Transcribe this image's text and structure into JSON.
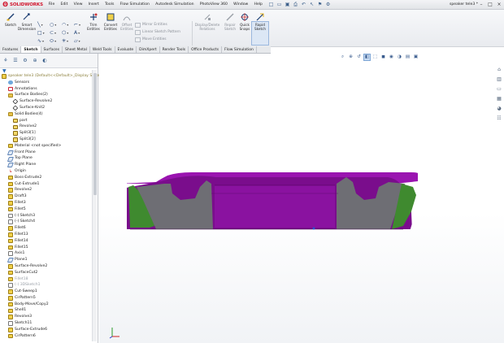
{
  "app": {
    "logo_text": "SOLIDWORKS",
    "doc_title": "speaker tele3 *"
  },
  "menu": [
    "File",
    "Edit",
    "View",
    "Insert",
    "Tools",
    "Flow Simulation",
    "Autodesk Simulation",
    "PhotoView 360",
    "Window",
    "Help"
  ],
  "command_manager": {
    "big": [
      {
        "label": "Sketch"
      },
      {
        "label": "Smart\nDimension"
      },
      {
        "label": "Trim\nEntities"
      },
      {
        "label": "Convert\nEntities"
      },
      {
        "label": "Offset\nEntities"
      },
      {
        "label": "Display/Delete\nRelations"
      },
      {
        "label": "Repair\nSketch"
      },
      {
        "label": "Quick\nSnaps"
      },
      {
        "label": "Rapid\nSketch"
      }
    ],
    "list": [
      "Mirror Entities",
      "Linear Sketch Pattern",
      "Move Entities"
    ]
  },
  "tabs": [
    "Features",
    "Sketch",
    "Surfaces",
    "Sheet Metal",
    "Weld Tools",
    "Evaluate",
    "DimXpert",
    "Render Tools",
    "Office Products",
    "Flow Simulation"
  ],
  "active_tab": "Sketch",
  "tree": [
    {
      "label": "speaker tele3 (Default<<Default>_Display State 1>)",
      "indent": 0,
      "icon": "root",
      "root": true
    },
    {
      "label": "Sensors",
      "indent": 1,
      "icon": "sensor"
    },
    {
      "label": "Annotations",
      "indent": 1,
      "icon": "anno"
    },
    {
      "label": "Surface Bodies(2)",
      "indent": 1,
      "icon": "folder"
    },
    {
      "label": "Surface-Revolve2",
      "indent": 2,
      "icon": "surf"
    },
    {
      "label": "Surface-Knit2",
      "indent": 2,
      "icon": "surf"
    },
    {
      "label": "Solid Bodies(4)",
      "indent": 1,
      "icon": "folder"
    },
    {
      "label": "part",
      "indent": 2,
      "icon": "solid"
    },
    {
      "label": "Revolve2",
      "indent": 2,
      "icon": "solid"
    },
    {
      "label": "Split3[1]",
      "indent": 2,
      "icon": "solid"
    },
    {
      "label": "Split3[2]",
      "indent": 2,
      "icon": "solid"
    },
    {
      "label": "Material <not specified>",
      "indent": 1,
      "icon": "feat"
    },
    {
      "label": "Front Plane",
      "indent": 1,
      "icon": "plane"
    },
    {
      "label": "Top Plane",
      "indent": 1,
      "icon": "plane"
    },
    {
      "label": "Right Plane",
      "indent": 1,
      "icon": "plane"
    },
    {
      "label": "Origin",
      "indent": 1,
      "icon": "origin"
    },
    {
      "label": "Boss-Extrude2",
      "indent": 1,
      "icon": "feat"
    },
    {
      "label": "Cut-Extrude1",
      "indent": 1,
      "icon": "feat"
    },
    {
      "label": "Revolve2",
      "indent": 1,
      "icon": "feat"
    },
    {
      "label": "Draft3",
      "indent": 1,
      "icon": "feat"
    },
    {
      "label": "Fillet3",
      "indent": 1,
      "icon": "feat"
    },
    {
      "label": "Fillet5",
      "indent": 1,
      "icon": "feat"
    },
    {
      "label": "(-) Sketch3",
      "indent": 1,
      "icon": "sketch"
    },
    {
      "label": "(-) Sketch4",
      "indent": 1,
      "icon": "sketch"
    },
    {
      "label": "Fillet6",
      "indent": 1,
      "icon": "feat"
    },
    {
      "label": "Fillet13",
      "indent": 1,
      "icon": "feat"
    },
    {
      "label": "Fillet14",
      "indent": 1,
      "icon": "feat"
    },
    {
      "label": "Fillet15",
      "indent": 1,
      "icon": "feat"
    },
    {
      "label": "Axis1",
      "indent": 1,
      "icon": "sketch"
    },
    {
      "label": "Plane1",
      "indent": 1,
      "icon": "plane"
    },
    {
      "label": "Surface-Revolve2",
      "indent": 1,
      "icon": "feat"
    },
    {
      "label": "SurfaceCut2",
      "indent": 1,
      "icon": "feat"
    },
    {
      "label": "Fillet18",
      "indent": 1,
      "icon": "feat",
      "dim": true
    },
    {
      "label": "(-) 3DSketch1",
      "indent": 1,
      "icon": "sketch",
      "dim": true
    },
    {
      "label": "Cut-Sweep1",
      "indent": 1,
      "icon": "feat"
    },
    {
      "label": "CirPattern5",
      "indent": 1,
      "icon": "feat"
    },
    {
      "label": "Body-Move/Copy2",
      "indent": 1,
      "icon": "feat"
    },
    {
      "label": "Shell1",
      "indent": 1,
      "icon": "feat"
    },
    {
      "label": "Revolve3",
      "indent": 1,
      "icon": "feat"
    },
    {
      "label": "Sketch11",
      "indent": 1,
      "icon": "sketch"
    },
    {
      "label": "Surface-Extrude6",
      "indent": 1,
      "icon": "feat"
    },
    {
      "label": "CirPattern6",
      "indent": 1,
      "icon": "feat"
    }
  ],
  "colors": {
    "model_purple": "#7a0d8c",
    "model_top": "#9a14b0",
    "model_green": "#3f8a2f",
    "model_gray": "#6e6e74",
    "brand_red": "#d2142c"
  }
}
